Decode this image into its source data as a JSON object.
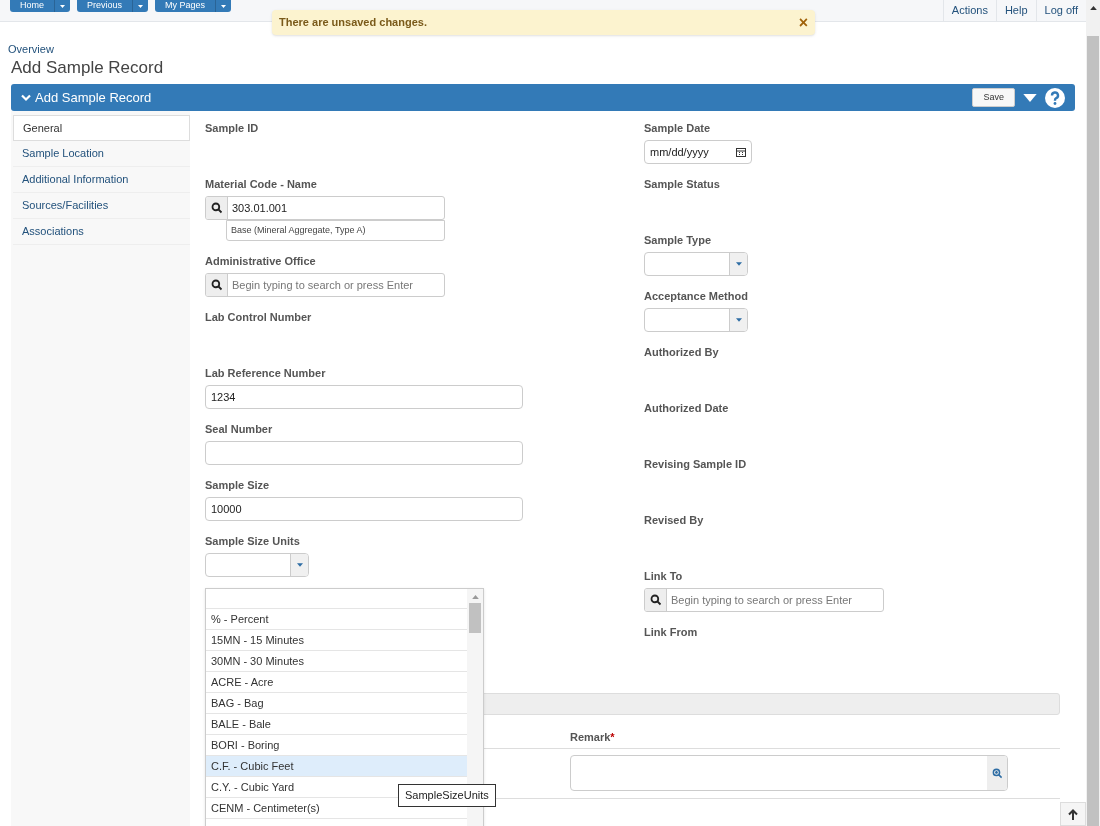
{
  "top_nav": {
    "buttons": [
      {
        "label": "Home"
      },
      {
        "label": "Previous"
      },
      {
        "label": "My Pages"
      }
    ],
    "links": [
      "Actions",
      "Help",
      "Log off"
    ]
  },
  "toast": {
    "message": "There are unsaved changes.",
    "close": "×"
  },
  "breadcrumb": "Overview",
  "page_title": "Add Sample Record",
  "panel": {
    "title": "Add Sample Record",
    "save": "Save"
  },
  "sidebar": {
    "items": [
      {
        "label": "General",
        "selected": true
      },
      {
        "label": "Sample Location",
        "selected": false
      },
      {
        "label": "Additional Information",
        "selected": false
      },
      {
        "label": "Sources/Facilities",
        "selected": false
      },
      {
        "label": "Associations",
        "selected": false
      }
    ]
  },
  "left_fields": [
    {
      "kind": "readonly",
      "label": "Sample ID"
    },
    {
      "kind": "lookup",
      "label": "Material Code - Name",
      "value": "303.01.001",
      "description": "Base (Mineral Aggregate, Type A)"
    },
    {
      "kind": "lookup",
      "label": "Administrative Office",
      "placeholder": "Begin typing to search or press Enter"
    },
    {
      "kind": "readonly",
      "label": "Lab Control Number"
    },
    {
      "kind": "text",
      "label": "Lab Reference Number",
      "value": "1234"
    },
    {
      "kind": "text",
      "label": "Seal Number"
    },
    {
      "kind": "text",
      "label": "Sample Size",
      "value": "10000"
    },
    {
      "kind": "select",
      "label": "Sample Size Units"
    }
  ],
  "right_fields": [
    {
      "kind": "date",
      "label": "Sample Date",
      "placeholder": "mm/dd/yyyy"
    },
    {
      "kind": "readonly",
      "label": "Sample Status"
    },
    {
      "kind": "select",
      "label": "Sample Type"
    },
    {
      "kind": "select",
      "label": "Acceptance Method"
    },
    {
      "kind": "readonly",
      "label": "Authorized By"
    },
    {
      "kind": "readonly",
      "label": "Authorized Date"
    },
    {
      "kind": "readonly",
      "label": "Revising Sample ID"
    },
    {
      "kind": "readonly",
      "label": "Revised By"
    },
    {
      "kind": "lookup",
      "label": "Link To",
      "placeholder": "Begin typing to search or press Enter"
    },
    {
      "kind": "readonly",
      "label": "Link From"
    }
  ],
  "remarks": {
    "column": "Remark",
    "required": "*"
  },
  "dropdown": {
    "options": [
      {
        "label": "% - Percent",
        "selected": false
      },
      {
        "label": "15MN - 15 Minutes",
        "selected": false
      },
      {
        "label": "30MN - 30 Minutes",
        "selected": false
      },
      {
        "label": "ACRE - Acre",
        "selected": false
      },
      {
        "label": "BAG - Bag",
        "selected": false
      },
      {
        "label": "BALE - Bale",
        "selected": false
      },
      {
        "label": "BORI - Boring",
        "selected": false
      },
      {
        "label": "C.F. - Cubic Feet",
        "selected": true
      },
      {
        "label": "C.Y. - Cubic Yard",
        "selected": false
      },
      {
        "label": "CENM - Centimeter(s)",
        "selected": false
      }
    ]
  },
  "tooltip": "SampleSizeUnits"
}
